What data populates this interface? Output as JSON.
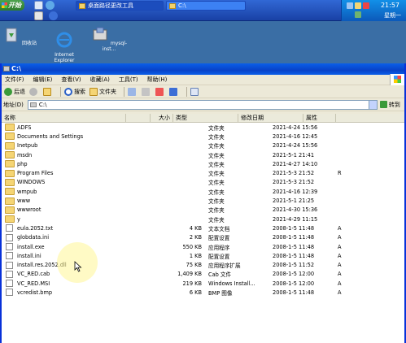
{
  "taskbar": {
    "start_label": "开始",
    "task_buttons": [
      "桌面路径更改工具",
      "C:\\"
    ],
    "clock": "21:57",
    "dayname": "星期一"
  },
  "desktop": {
    "icons": [
      "回收站",
      "Internet\nExplorer",
      "mysql-inst..."
    ]
  },
  "window": {
    "title": "C:\\",
    "menu": [
      "文件(F)",
      "编辑(E)",
      "查看(V)",
      "收藏(A)",
      "工具(T)",
      "帮助(H)"
    ],
    "toolbar": {
      "back": "后退",
      "search": "搜索",
      "folders": "文件夹"
    },
    "address": {
      "label": "地址(D)",
      "value": "C:\\",
      "go": "转到"
    },
    "columns": [
      "名称",
      "大小",
      "类型",
      "修改日期",
      "属性"
    ],
    "files": [
      {
        "name": "ADFS",
        "size": "",
        "type": "文件夹",
        "date": "2021-4-24 15:56",
        "attr": "",
        "kind": "folder"
      },
      {
        "name": "Documents and Settings",
        "size": "",
        "type": "文件夹",
        "date": "2021-4-16 12:45",
        "attr": "",
        "kind": "folder"
      },
      {
        "name": "Inetpub",
        "size": "",
        "type": "文件夹",
        "date": "2021-4-24 15:56",
        "attr": "",
        "kind": "folder"
      },
      {
        "name": "msdn",
        "size": "",
        "type": "文件夹",
        "date": "2021-5-1 21:41",
        "attr": "",
        "kind": "folder"
      },
      {
        "name": "php",
        "size": "",
        "type": "文件夹",
        "date": "2021-4-27 14:10",
        "attr": "",
        "kind": "folder"
      },
      {
        "name": "Program Files",
        "size": "",
        "type": "文件夹",
        "date": "2021-5-3 21:52",
        "attr": "R",
        "kind": "folder"
      },
      {
        "name": "WINDOWS",
        "size": "",
        "type": "文件夹",
        "date": "2021-5-3 21:52",
        "attr": "",
        "kind": "folder"
      },
      {
        "name": "wmpub",
        "size": "",
        "type": "文件夹",
        "date": "2021-4-16 12:39",
        "attr": "",
        "kind": "folder"
      },
      {
        "name": "www",
        "size": "",
        "type": "文件夹",
        "date": "2021-5-1 21:25",
        "attr": "",
        "kind": "folder"
      },
      {
        "name": "wwwroot",
        "size": "",
        "type": "文件夹",
        "date": "2021-4-30 15:36",
        "attr": "",
        "kind": "folder"
      },
      {
        "name": "y",
        "size": "",
        "type": "文件夹",
        "date": "2021-4-29 11:15",
        "attr": "",
        "kind": "folder"
      },
      {
        "name": "eula.2052.txt",
        "size": "4 KB",
        "type": "文本文档",
        "date": "2008-1-5 11:48",
        "attr": "A",
        "kind": "file"
      },
      {
        "name": "globdata.ini",
        "size": "2 KB",
        "type": "配置设置",
        "date": "2008-1-5 11:48",
        "attr": "A",
        "kind": "file"
      },
      {
        "name": "install.exe",
        "size": "550 KB",
        "type": "应用程序",
        "date": "2008-1-5 11:48",
        "attr": "A",
        "kind": "file"
      },
      {
        "name": "install.ini",
        "size": "1 KB",
        "type": "配置设置",
        "date": "2008-1-5 11:48",
        "attr": "A",
        "kind": "file"
      },
      {
        "name": "install.res.2052.dll",
        "size": "75 KB",
        "type": "应用程序扩展",
        "date": "2008-1-5 11:52",
        "attr": "A",
        "kind": "file"
      },
      {
        "name": "VC_RED.cab",
        "size": "1,409 KB",
        "type": "Cab 文件",
        "date": "2008-1-5 12:00",
        "attr": "A",
        "kind": "file"
      },
      {
        "name": "VC_RED.MSI",
        "size": "219 KB",
        "type": "Windows Install...",
        "date": "2008-1-5 12:00",
        "attr": "A",
        "kind": "file"
      },
      {
        "name": "vcredist.bmp",
        "size": "6 KB",
        "type": "BMP 图像",
        "date": "2008-1-5 11:48",
        "attr": "A",
        "kind": "file"
      }
    ]
  }
}
